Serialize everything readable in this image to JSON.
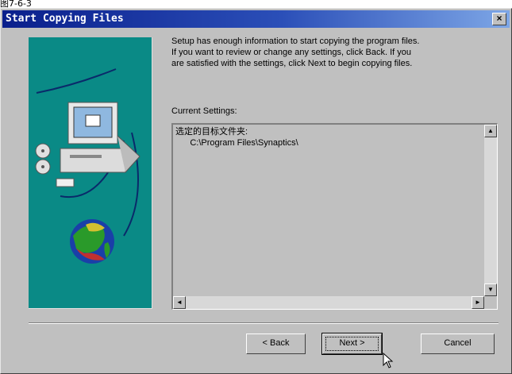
{
  "page_caption": "图7-6-3",
  "window": {
    "title": "Start Copying Files",
    "close_label": "×"
  },
  "description": {
    "line1": "Setup has enough information to start copying the program files.",
    "line2": "If you want to review or change any settings, click Back.  If you",
    "line3": "are satisfied with the settings, click Next to begin copying files."
  },
  "settings": {
    "label": "Current Settings:",
    "line1": "选定的目标文件夹:",
    "line2": "      C:\\Program Files\\Synaptics\\"
  },
  "scrollbars": {
    "up": "▲",
    "down": "▼",
    "left": "◄",
    "right": "►"
  },
  "buttons": {
    "back": "< Back",
    "next": "Next >",
    "cancel": "Cancel"
  },
  "colors": {
    "title_start": "#0a1f8c",
    "art_background": "#0a8a86"
  }
}
